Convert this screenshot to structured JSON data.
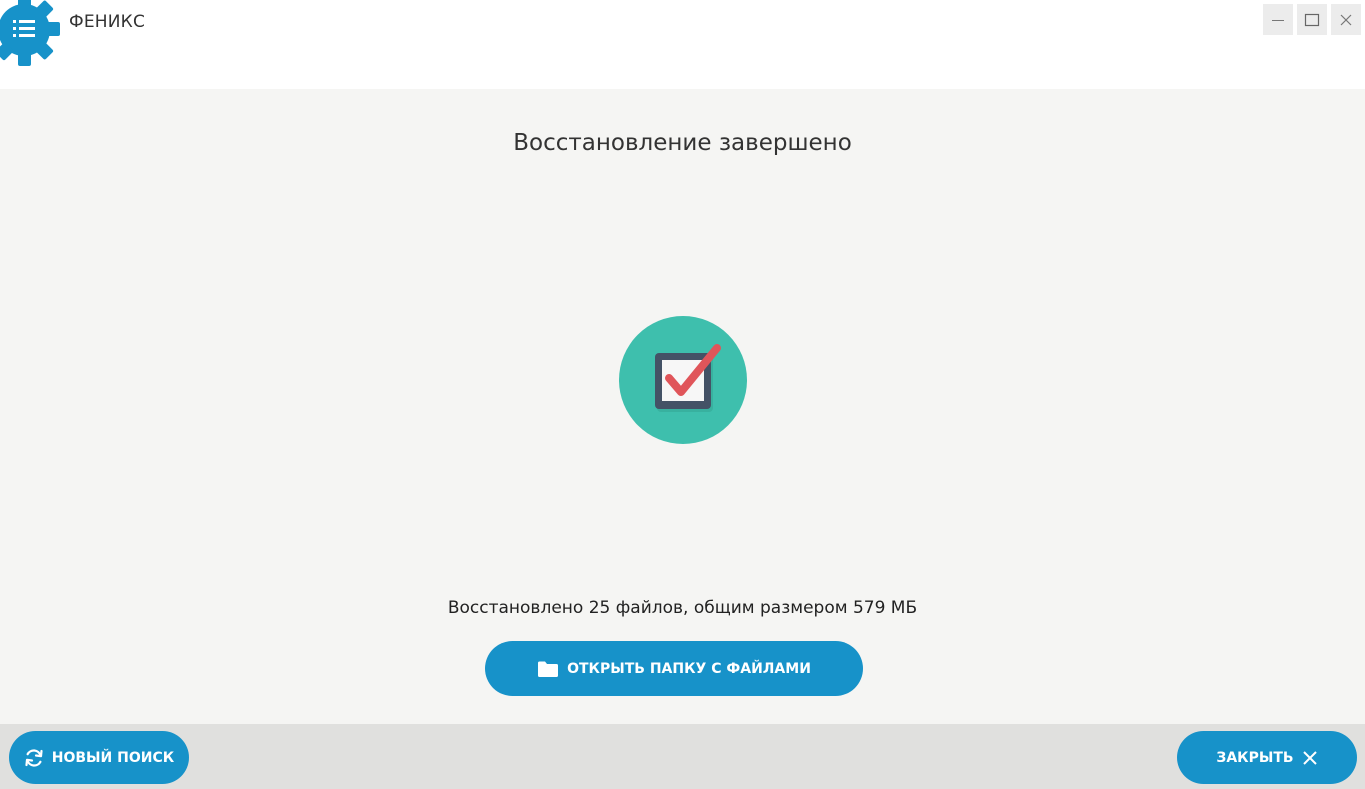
{
  "app": {
    "title": "ФЕНИКС"
  },
  "main": {
    "heading": "Восстановление завершено",
    "summary": "Восстановлено 25 файлов, общим размером 579 МБ",
    "open_folder_label": "ОТКРЫТЬ ПАПКУ С ФАЙЛАМИ"
  },
  "footer": {
    "new_search_label": "НОВЫЙ ПОИСК",
    "close_label": "ЗАКРЫТЬ"
  },
  "icons": {
    "logo": "gear-menu-icon",
    "minimize": "minimize-icon",
    "maximize": "maximize-icon",
    "close": "close-icon",
    "success": "checkbox-checked-icon",
    "folder": "folder-icon",
    "refresh": "refresh-icon",
    "close_x": "close-x-icon"
  },
  "colors": {
    "accent": "#1792c9",
    "success_circle": "#3ebfad",
    "check": "#e0555a",
    "background": "#f5f5f3",
    "footer": "#e0e0de"
  }
}
